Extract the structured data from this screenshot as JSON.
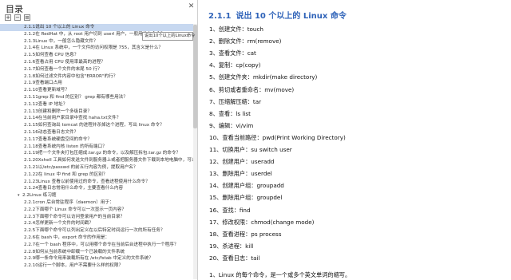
{
  "toc": {
    "title": "目录",
    "tooltip": "说出10个以上的Linux命令",
    "items": [
      {
        "label": "2.1.1说出 10 个以上的 Linux 命令",
        "level": 3,
        "selected": true
      },
      {
        "label": "2.1.2在 RedHat 中，从 root 用户切到 userl 用户，一般用什么命令？",
        "level": 3
      },
      {
        "label": "2.1.3Linux 中，一般怎么隐藏文件？",
        "level": 3
      },
      {
        "label": "2.1.4在 Linux 系统中，一个文件的访问权限是 755，其含义是什么？",
        "level": 3
      },
      {
        "label": "2.1.5如何查看 CPU 信息？",
        "level": 3
      },
      {
        "label": "2.1.6查看占用 CPU 使用率最高的进程？",
        "level": 3
      },
      {
        "label": "2.1.7如何查看一个文件的末尾 50 行？",
        "level": 3
      },
      {
        "label": "2.1.8如何过滤文件内容中包含\"ERROR\"的行？",
        "level": 3
      },
      {
        "label": "2.1.9查看端口占用",
        "level": 3
      },
      {
        "label": "2.1.10查看更新域号？",
        "level": 3
      },
      {
        "label": "2.1.11grep 和 find 的区别？ grep 都有哪些用法？",
        "level": 3
      },
      {
        "label": "2.1.12查看 IP 地址？",
        "level": 3
      },
      {
        "label": "2.1.13创建和删除一个多级目录？",
        "level": 3
      },
      {
        "label": "2.1.14在当前用户家目录中查找 haha.txt文件？",
        "level": 3
      },
      {
        "label": "2.1.15如何查询出 tomcat 的进程并杀掉这个进程，写出 linux 命令？",
        "level": 3
      },
      {
        "label": "2.1.16动态查看日志文件？",
        "level": 3
      },
      {
        "label": "2.1.17查看系统硬盘空间的命令？",
        "level": 3
      },
      {
        "label": "2.1.18查看系统内核 listen 的所有端口？",
        "level": 3
      },
      {
        "label": "2.1.19把一个文件夹打包压缩成.tar.gz 的命令，以及解压拆包.tar.gz 的命令？",
        "level": 3
      },
      {
        "label": "2.1.20Xshell 工具如何发送文件到服务器上或者把服务器文件下载到本地电脑中，可以在服务器上执行什么命令？",
        "level": 3
      },
      {
        "label": "2.1.21以/etc/passwd 的前五行内容为例，提取用户名？",
        "level": 3
      },
      {
        "label": "2.1.22在 linux 中 find 和 grep 的区别？",
        "level": 3
      },
      {
        "label": "2.1.23Linux 查看以前使用过的命令，查看进程使用什么命令？",
        "level": 3
      },
      {
        "label": "2.1.24查看日志常用什么命令，主要查看什么内容",
        "level": 3
      },
      {
        "label": "2.2Linux 练习题",
        "level": 2,
        "expanded": true
      },
      {
        "label": "2.2.1cron 后台常驻程序（daemon）用于：",
        "level": 3
      },
      {
        "label": "2.2.2下面哪个 Linux 命令可以一次显示一页内容？",
        "level": 3
      },
      {
        "label": "2.2.3下面哪个命令可以访问登录用户的当前目录？",
        "level": 3
      },
      {
        "label": "2.2.4怎样更新一个文件的时间戳？",
        "level": 3
      },
      {
        "label": "2.2.5下面哪个命令可以列出定义在以后特定时间运行一次的所有任务？",
        "level": 3
      },
      {
        "label": "2.2.6在 bash 中，export 命令的作用是：",
        "level": 3
      },
      {
        "label": "2.2.7在一个 bash 程序中，可以用哪个命令在当前后台进程中执行一个程序？",
        "level": 3
      },
      {
        "label": "2.2.8如何从当前系统中卸载一个已装载的文件系统",
        "level": 3
      },
      {
        "label": "2.2.9哪一条命令用来装载所有在 /etc/fstab 中定义的文件系统？",
        "level": 3
      },
      {
        "label": "2.2.10运行一个脚本，用户不需要什么样的权限？",
        "level": 3
      }
    ]
  },
  "doc": {
    "section_number": "2.1.1",
    "section_title": "说出 10 个以上的 Linux 命令",
    "commands": [
      "1、创建文件：touch",
      "2、删除文件：rm(remove)",
      "3、查看文件：cat",
      "4、复制：cp(copy)",
      "5、创建文件夹：mkdir(make directory)",
      "6、剪切或者重命名：mv(move)",
      "7、压缩解压缩：tar",
      "8、查看：ls   list",
      "9、编辑：vi/vim",
      "10、查看当前路径：pwd(Print Working Directory)",
      "11、切换用户：su    switch user",
      "12、创建用户：useradd",
      "13、删除用户：userdel",
      "14、创建用户组：groupadd",
      "15、删除用户组：groupdel",
      "16、查找：find",
      "17、修改权限：chmod(change mode)",
      "18、查看进程：ps   process",
      "19、杀进程：kill",
      "20、查看日志：tail"
    ],
    "closing_line": "1、Linux 的每个命令，是一个或多个英文单词的缩写。"
  }
}
